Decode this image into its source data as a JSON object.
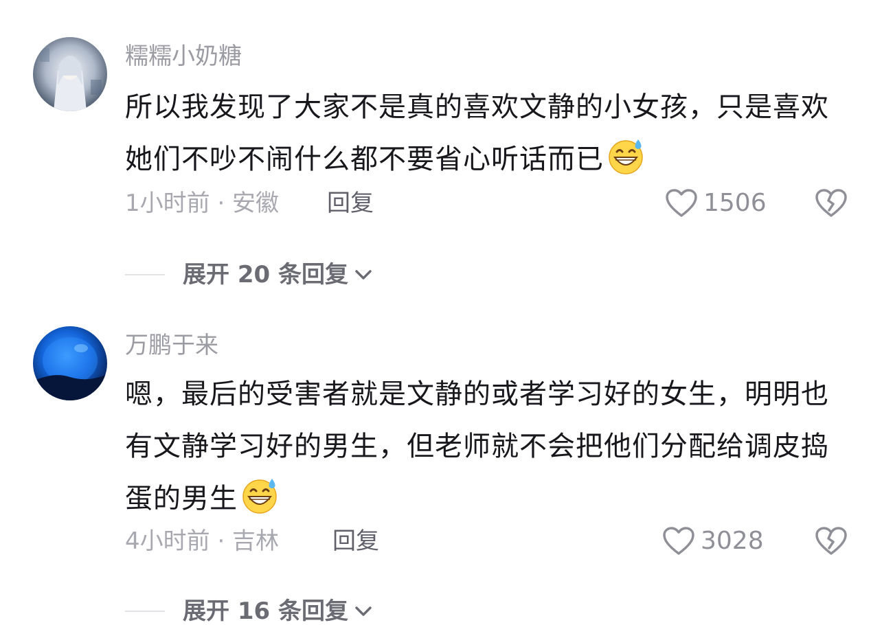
{
  "comments": [
    {
      "username": "糯糯小奶糖",
      "text": "所以我发现了大家不是真的喜欢文静的小女孩，只是喜欢她们不吵不闹什么都不要省心听话而已",
      "emoji": "grinning-sweat-emoji",
      "meta": "1小时前 · 安徽",
      "reply_label": "回复",
      "likes": "1506",
      "expand_label": "展开 20 条回复"
    },
    {
      "username": "万鹏于来",
      "text": "嗯，最后的受害者就是文静的或者学习好的女生，明明也有文静学习好的男生，但老师就不会把他们分配给调皮捣蛋的男生",
      "emoji": "grinning-sweat-emoji",
      "meta": "4小时前 · 吉林",
      "reply_label": "回复",
      "likes": "3028",
      "expand_label": "展开 16 条回复"
    }
  ],
  "icons": {
    "like": "heart-outline-icon",
    "dislike": "broken-heart-icon",
    "expand": "chevron-down-icon"
  },
  "colors": {
    "username": "#9b9ba3",
    "body": "#17171c",
    "meta": "#a8a8b0",
    "reply": "#60606a",
    "expand": "#6b6b74"
  }
}
